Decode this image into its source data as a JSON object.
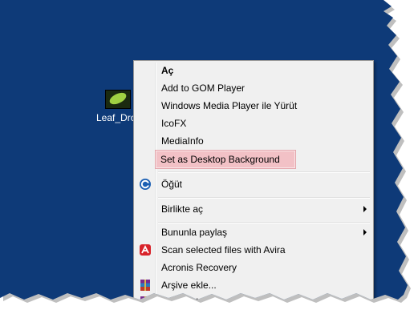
{
  "desktop": {
    "file_label": "Leaf_Dro"
  },
  "menu": {
    "items": [
      {
        "label": "Aç",
        "icon": ""
      },
      {
        "label": "Add to GOM Player",
        "icon": ""
      },
      {
        "label": "Windows Media Player ile Yürüt",
        "icon": ""
      },
      {
        "label": "IcoFX",
        "icon": ""
      },
      {
        "label": "MediaInfo",
        "icon": ""
      },
      {
        "label": "Set as Desktop Background",
        "icon": ""
      },
      {
        "label": "Öğüt",
        "icon": "ccleaner-icon"
      },
      {
        "label": "Birlikte aç",
        "icon": "",
        "submenu": true
      },
      {
        "label": "Bununla paylaş",
        "icon": "",
        "submenu": true
      },
      {
        "label": "Scan selected files with Avira",
        "icon": "avira-icon"
      },
      {
        "label": "Acronis Recovery",
        "icon": ""
      },
      {
        "label": "Arşive ekle...",
        "icon": "winrar-icon"
      },
      {
        "label": "Arşive ekle \"Leaf_Drop.rar\"",
        "icon": "winrar-icon"
      }
    ],
    "highlight_color": "#f2c1c6"
  }
}
